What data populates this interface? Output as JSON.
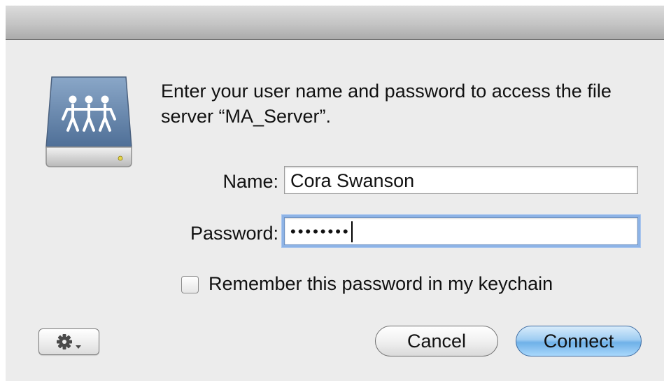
{
  "dialog": {
    "message": "Enter your user name and password to access the file server “MA_Server”."
  },
  "form": {
    "name_label": "Name:",
    "name_value": "Cora Swanson",
    "password_label": "Password:",
    "password_masked": "••••••••",
    "remember_label": "Remember this password in my keychain",
    "remember_checked": false
  },
  "buttons": {
    "action_icon": "gear-icon",
    "cancel_label": "Cancel",
    "connect_label": "Connect"
  },
  "colors": {
    "connect_accent": "#7ab8ea",
    "focus_ring": "#8db3e6"
  }
}
